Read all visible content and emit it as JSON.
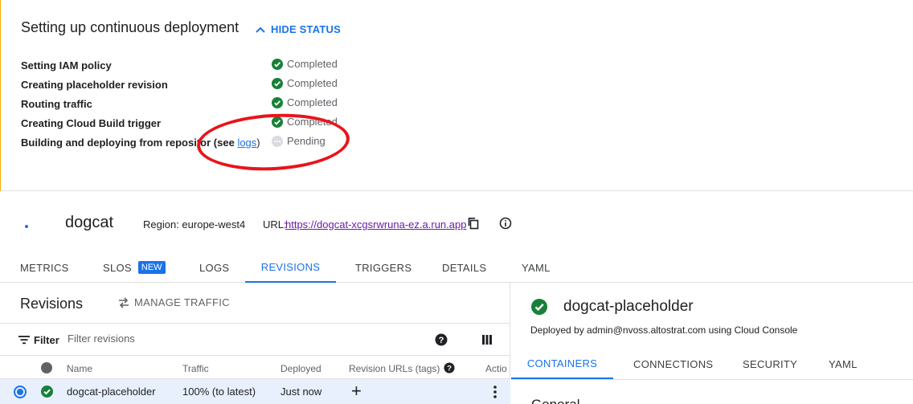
{
  "status_panel": {
    "title": "Setting up continuous deployment",
    "hide_status_label": "HIDE STATUS",
    "steps": [
      {
        "label": "Setting IAM policy",
        "status": "Completed",
        "state": "completed"
      },
      {
        "label": "Creating placeholder revision",
        "status": "Completed",
        "state": "completed"
      },
      {
        "label": "Routing traffic",
        "status": "Completed",
        "state": "completed"
      },
      {
        "label": "Creating Cloud Build trigger",
        "status": "Completed",
        "state": "completed"
      },
      {
        "label": "Building and deploying from repository",
        "label_prefix": "Building and deploying from repositor",
        "link_open": "(see ",
        "link_text": "logs",
        "link_close": ")",
        "status": "Pending",
        "state": "pending"
      }
    ]
  },
  "service": {
    "name": "dogcat",
    "region": "Region: europe-west4",
    "url_label": "URL:",
    "url": "https://dogcat-xcgsrwruna-ez.a.run.app"
  },
  "tabs": [
    {
      "label": "METRICS",
      "active": false
    },
    {
      "label": "SLOS",
      "badge": "NEW",
      "active": false
    },
    {
      "label": "LOGS",
      "active": false
    },
    {
      "label": "REVISIONS",
      "active": true
    },
    {
      "label": "TRIGGERS",
      "active": false
    },
    {
      "label": "DETAILS",
      "active": false
    },
    {
      "label": "YAML",
      "active": false
    }
  ],
  "revisions": {
    "title": "Revisions",
    "manage_traffic_label": "MANAGE TRAFFIC",
    "filter_label": "Filter",
    "filter_placeholder": "Filter revisions",
    "columns": [
      "Name",
      "Traffic",
      "Deployed",
      "Revision URLs (tags)",
      "Actio"
    ],
    "rows": [
      {
        "name": "dogcat-placeholder",
        "traffic": "100% (to latest)",
        "deployed": "Just now",
        "selected": true,
        "status": "completed"
      }
    ]
  },
  "detail": {
    "title": "dogcat-placeholder",
    "subtitle": "Deployed by admin@nvoss.altostrat.com using Cloud Console",
    "tabs": [
      {
        "label": "CONTAINERS",
        "active": true
      },
      {
        "label": "CONNECTIONS",
        "active": false
      },
      {
        "label": "SECURITY",
        "active": false
      },
      {
        "label": "YAML",
        "active": false
      }
    ],
    "section_heading_partial": "General"
  },
  "colors": {
    "accent": "#1a73e8",
    "success": "#188038",
    "pending": "#bdc1c6",
    "annotation": "#e8141b",
    "visited_link": "#681da8"
  },
  "icons": [
    "chevron-up-icon",
    "check-circle-icon",
    "more-horiz-icon",
    "copy-icon",
    "info-icon",
    "swap-horiz-icon",
    "filter-list-icon",
    "help-icon",
    "view-column-icon",
    "add-icon",
    "more-vert-icon"
  ]
}
